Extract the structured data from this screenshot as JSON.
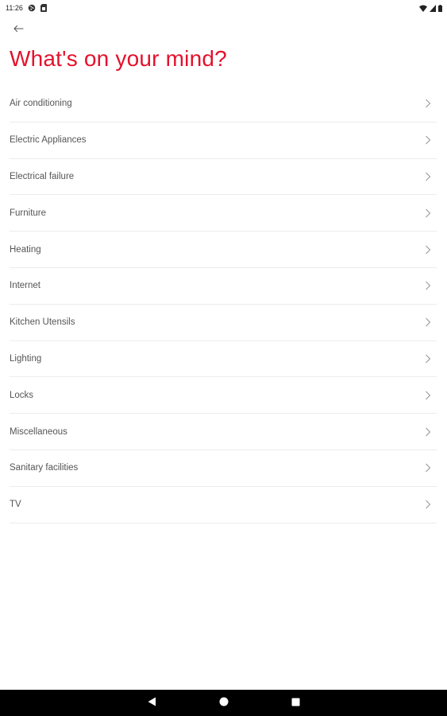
{
  "status_bar": {
    "time": "11:26",
    "icons": [
      "globe-icon",
      "sim-card-icon",
      "wifi-icon",
      "signal-icon",
      "battery-icon"
    ]
  },
  "header": {
    "back_icon": "arrow-left-icon",
    "title": "What's on your mind?"
  },
  "accent_color": "#e4122c",
  "categories": [
    {
      "label": "Air conditioning"
    },
    {
      "label": "Electric Appliances"
    },
    {
      "label": "Electrical failure"
    },
    {
      "label": "Furniture"
    },
    {
      "label": "Heating"
    },
    {
      "label": "Internet"
    },
    {
      "label": "Kitchen Utensils"
    },
    {
      "label": "Lighting"
    },
    {
      "label": "Locks"
    },
    {
      "label": "Miscellaneous"
    },
    {
      "label": "Sanitary facilities"
    },
    {
      "label": "TV"
    }
  ],
  "nav_bar": {
    "buttons": [
      "back-triangle-icon",
      "home-circle-icon",
      "recents-square-icon"
    ]
  }
}
